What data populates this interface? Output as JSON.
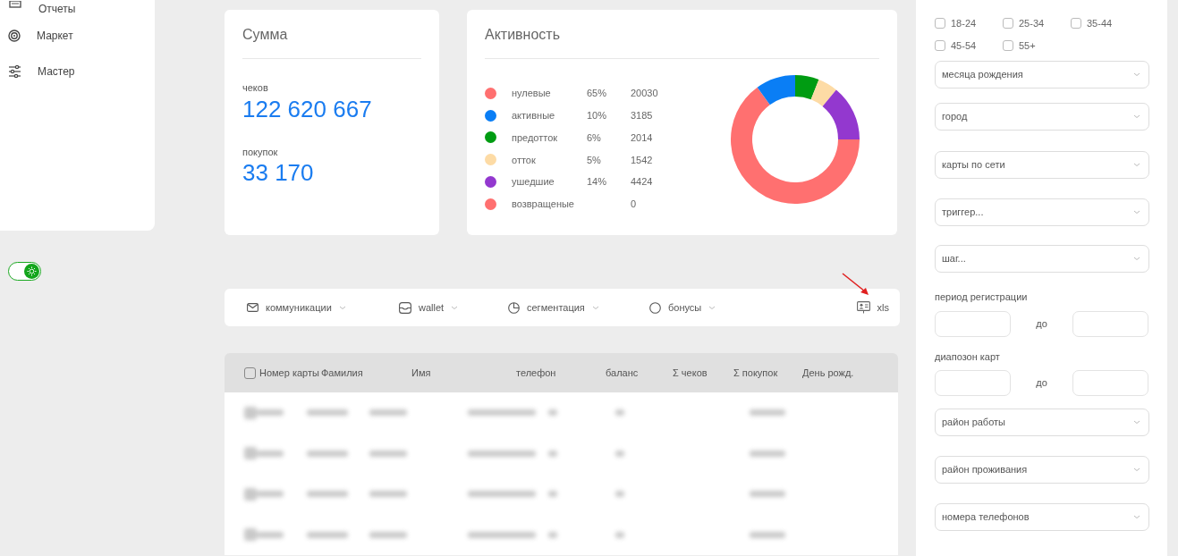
{
  "sidebar": {
    "items": [
      {
        "label": "Отчеты"
      },
      {
        "label": "Маркет"
      },
      {
        "label": "Мастер"
      }
    ],
    "theme_toggle": {
      "on": true
    }
  },
  "summary_card": {
    "title": "Сумма",
    "metrics": [
      {
        "label": "чеков",
        "value": "122 620 667"
      },
      {
        "label": "покупок",
        "value": "33 170"
      }
    ]
  },
  "activity_card": {
    "title": "Активность",
    "legend": [
      {
        "label": "нулевые",
        "percent": "65%",
        "count": "20030",
        "color": "#ff7070"
      },
      {
        "label": "активные",
        "percent": "10%",
        "count": "3185",
        "color": "#0a7ef5"
      },
      {
        "label": "предотток",
        "percent": "6%",
        "count": "2014",
        "color": "#009c12"
      },
      {
        "label": "отток",
        "percent": "5%",
        "count": "1542",
        "color": "#fddba5"
      },
      {
        "label": "ушедшие",
        "percent": "14%",
        "count": "4424",
        "color": "#9338cf"
      },
      {
        "label": "возвращеные",
        "count": "0",
        "color": "#ff7070"
      }
    ],
    "chart_data": {
      "type": "donut",
      "values": [
        65,
        10,
        6,
        5,
        14,
        0
      ]
    }
  },
  "toolbar": {
    "menus": [
      {
        "label": "коммуникации"
      },
      {
        "label": "wallet"
      },
      {
        "label": "сегментация"
      },
      {
        "label": "бонусы"
      }
    ],
    "export": {
      "label": "xls"
    }
  },
  "table": {
    "select_all": {
      "checked": false
    },
    "columns": [
      "Номер карты",
      "Фамилия",
      "Имя",
      "телефон",
      "баланс",
      "Σ чеков",
      "Σ покупок",
      "День рожд."
    ],
    "rows": [
      {
        "kind": "blurred"
      },
      {
        "kind": "blurred"
      },
      {
        "kind": "blurred"
      },
      {
        "kind": "blurred"
      }
    ]
  },
  "filters": {
    "age_groups": [
      {
        "label": "18-24",
        "checked": false
      },
      {
        "label": "25-34",
        "checked": false
      },
      {
        "label": "35-44",
        "checked": false
      },
      {
        "label": "45-54",
        "checked": false
      },
      {
        "label": "55+",
        "checked": false
      }
    ],
    "controls": [
      {
        "kind": "select",
        "placeholder": "месяца рождения"
      },
      {
        "kind": "select",
        "placeholder": "город"
      },
      {
        "kind": "select",
        "placeholder": "карты по сети"
      },
      {
        "kind": "select",
        "placeholder": "триггер..."
      },
      {
        "kind": "select",
        "placeholder": "шаг..."
      },
      {
        "kind": "range",
        "label": "период регистрации",
        "separator": "до"
      },
      {
        "kind": "range",
        "label": "диапозон карт",
        "separator": "до"
      },
      {
        "kind": "select",
        "placeholder": "район работы"
      },
      {
        "kind": "select",
        "placeholder": "район проживания"
      },
      {
        "kind": "select",
        "placeholder": "номера телефонов"
      }
    ]
  }
}
